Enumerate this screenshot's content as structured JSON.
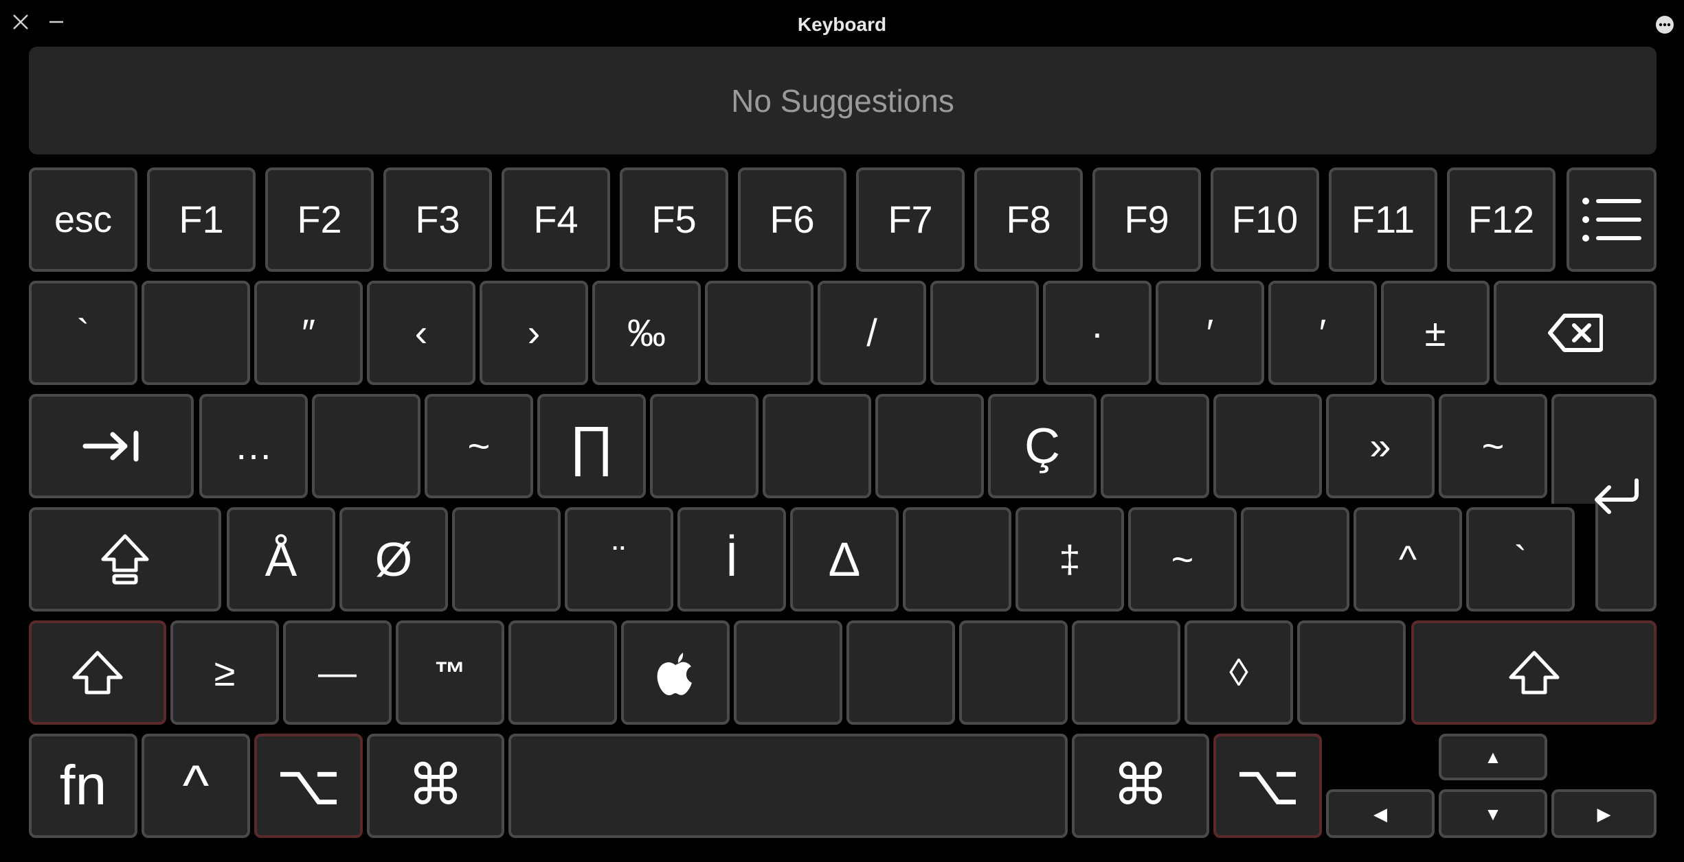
{
  "window": {
    "title": "Keyboard",
    "close_icon": "close-icon",
    "minimize_icon": "minimize-icon",
    "options_icon": "ellipsis-circle-icon"
  },
  "suggestions": {
    "text": "No Suggestions"
  },
  "row_function": [
    "esc",
    "F1",
    "F2",
    "F3",
    "F4",
    "F5",
    "F6",
    "F7",
    "F8",
    "F9",
    "F10",
    "F11",
    "F12"
  ],
  "row_number": [
    "`",
    "",
    "″",
    "‹",
    "›",
    "‰",
    "",
    "/",
    "",
    "·",
    "′",
    "′",
    "±"
  ],
  "row_tab": [
    "…",
    "",
    "~",
    "∏",
    "",
    "",
    "",
    "Ç",
    "",
    "",
    "»",
    "~"
  ],
  "row_caps": [
    "Å",
    "Ø",
    "",
    "¨",
    "İ",
    "∆",
    "",
    "‡",
    "~",
    "",
    "^",
    "`"
  ],
  "row_shift": [
    "≥",
    "—",
    "™",
    "",
    "apple-logo",
    "",
    "",
    "",
    "",
    "◊",
    ""
  ],
  "row_bottom": {
    "fn": "fn",
    "control": "^",
    "option": "⌥",
    "command": "⌘"
  },
  "arrows": {
    "up": "▲",
    "down": "▼",
    "left": "◀",
    "right": "▶"
  },
  "colors": {
    "key_bg": "#262626",
    "key_border": "#4a4a4a",
    "modifier_active_border": "#5a2a2a"
  }
}
